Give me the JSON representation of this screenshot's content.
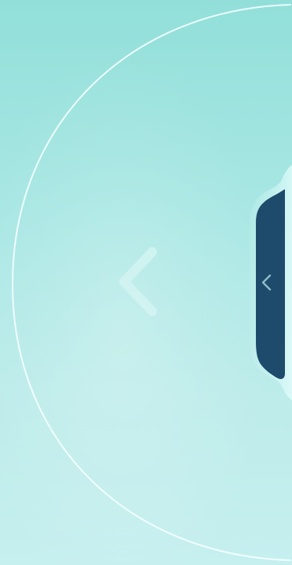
{
  "screen": {
    "background_top": "#92dfd9",
    "background_bottom": "#c6efef",
    "arc_color": "#f5ffff"
  },
  "center_control": {
    "icon_name": "chevron-left-icon",
    "icon_color": "#d7f5f4"
  },
  "edge_tab": {
    "icon_name": "chevron-left-icon",
    "fill_color": "#1e4b6b",
    "frame_color": "#d6f6f4",
    "icon_color": "#8fbcc8"
  }
}
